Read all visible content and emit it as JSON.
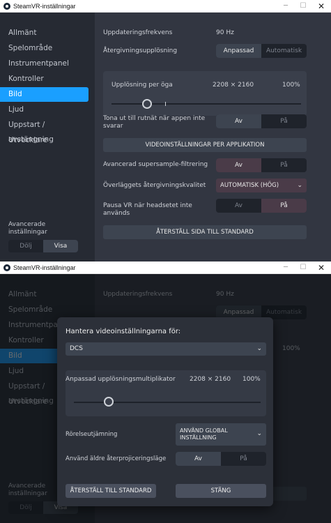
{
  "window": {
    "title": "SteamVR-inställningar",
    "min_glyph": "─",
    "max_glyph": "☐",
    "close_glyph": "✕"
  },
  "sidebar": {
    "items": [
      {
        "label": "Allmänt"
      },
      {
        "label": "Spelområde"
      },
      {
        "label": "Instrumentpanel"
      },
      {
        "label": "Kontroller"
      },
      {
        "label": "Bild"
      },
      {
        "label": "Ljud"
      },
      {
        "label": "Uppstart / avstängning"
      },
      {
        "label": "Utvecklare"
      }
    ],
    "active_item": "Bild",
    "advanced_label": "Avancerade inställningar",
    "toggle": {
      "hide": "Dölj",
      "show": "Visa",
      "selected": "Visa"
    }
  },
  "main": {
    "refresh_rate_label": "Uppdateringsfrekvens",
    "refresh_rate_value": "90 Hz",
    "render_res_label": "Återgivningsupplösning",
    "render_res_options": {
      "custom": "Anpassad",
      "auto": "Automatisk",
      "selected": "Anpassad"
    },
    "per_eye_label": "Upplösning per öga",
    "per_eye_resolution": "2208 × 2160",
    "per_eye_percent": "100%",
    "per_eye_percent_value": 100,
    "fade_grid_label": "Tona ut till rutnät när appen inte svarar",
    "fade_grid": {
      "off": "Av",
      "on": "På",
      "selected": "Av"
    },
    "per_app_video_button": "VIDEOINSTÄLLNINGAR PER APPLIKATION",
    "supersample_label": "Avancerad supersample-filtrering",
    "supersample": {
      "off": "Av",
      "on": "På",
      "selected": "Av"
    },
    "overlay_quality_label": "Överläggets återgivningskvalitet",
    "overlay_quality_value": "AUTOMATISK (HÖG)",
    "pause_vr_label": "Pausa VR när headsetet inte används",
    "pause_vr": {
      "off": "Av",
      "on": "På",
      "selected": "På"
    },
    "reset_button": "ÅTERSTÄLL SIDA TILL STANDARD"
  },
  "dialog": {
    "title": "Hantera videoinställningarna för:",
    "app_select_value": "DCS",
    "multiplier_label": "Anpassad upplösningsmultiplikator",
    "multiplier_resolution": "2208 × 2160",
    "multiplier_percent": "100%",
    "multiplier_percent_value": 100,
    "motion_smoothing_label": "Rörelseutjämning",
    "motion_smoothing_value": "ANVÄND GLOBAL INSTÄLLNING",
    "legacy_reprojection_label": "Använd äldre återprojiceringsläge",
    "legacy_reprojection": {
      "off": "Av",
      "on": "På",
      "selected": "Av"
    },
    "reset_button": "ÅTERSTÄLL TILL STANDARD",
    "close_button": "STÄNG"
  },
  "colors": {
    "accent": "#1a9fff",
    "background": "#323641",
    "sidebar": "#262a33",
    "selected_pink": "#4a3b48"
  },
  "icons": [
    "steamvr-app-icon",
    "minimize-icon",
    "maximize-icon",
    "close-icon",
    "chevron-down-icon"
  ]
}
